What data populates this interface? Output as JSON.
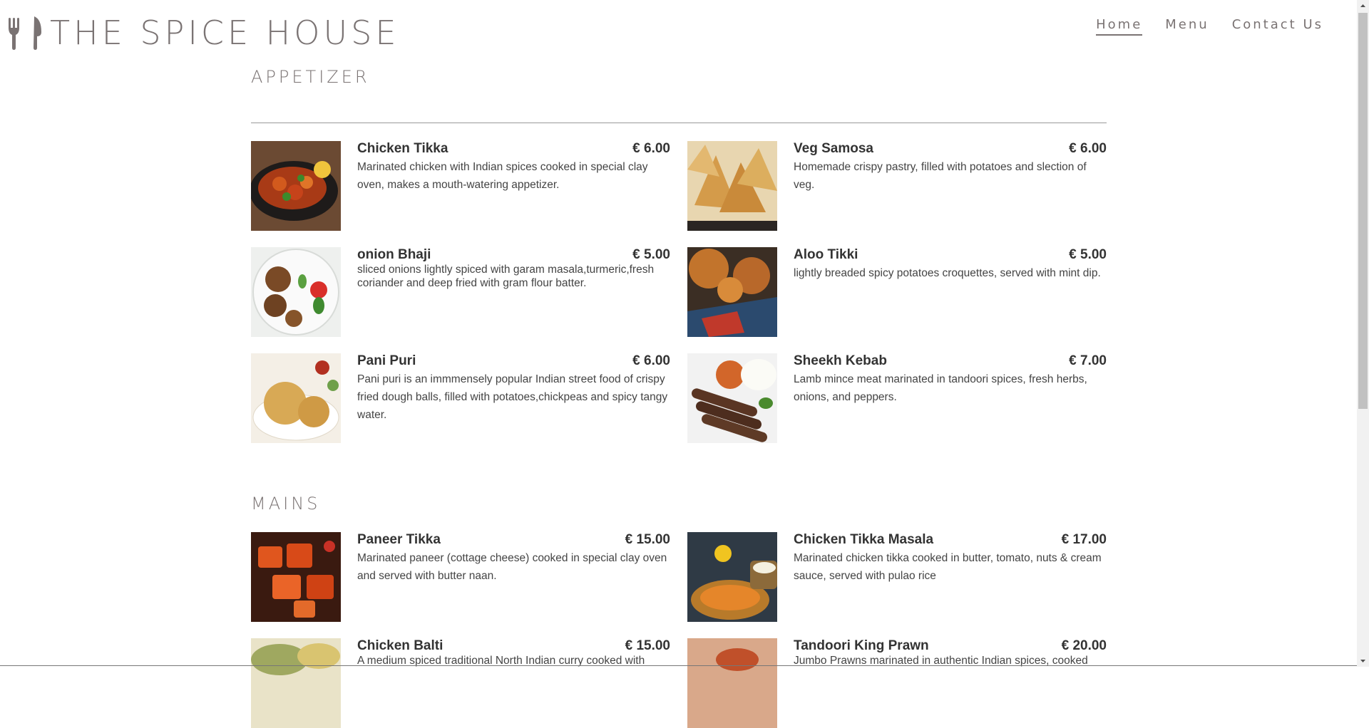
{
  "brand": {
    "title": "THE SPICE HOUSE",
    "icon": "fork-knife-icon"
  },
  "nav": [
    {
      "label": "Home",
      "active": true
    },
    {
      "label": "Menu",
      "active": false
    },
    {
      "label": "Contact Us",
      "active": false
    }
  ],
  "sections": [
    {
      "title": "APPETIZER",
      "items": [
        {
          "name": "Chicken Tikka",
          "price": "€ 6.00",
          "desc": "Marinated chicken with Indian spices cooked in special clay oven, makes a mouth-watering appetizer."
        },
        {
          "name": "Veg Samosa",
          "price": "€ 6.00",
          "desc": "Homemade crispy pastry, filled with potatoes and slection of veg."
        },
        {
          "name": "onion Bhaji",
          "price": "€ 5.00",
          "desc": "sliced onions lightly spiced with garam masala,turmeric,fresh coriander and deep fried with gram flour batter."
        },
        {
          "name": "Aloo Tikki",
          "price": "€ 5.00",
          "desc": "lightly breaded spicy potatoes croquettes, served with mint dip."
        },
        {
          "name": "Pani Puri",
          "price": "€ 6.00",
          "desc": "Pani puri is an immmensely popular Indian street food of crispy fried dough balls, filled with potatoes,chickpeas and spicy tangy water."
        },
        {
          "name": "Sheekh Kebab",
          "price": "€ 7.00",
          "desc": "Lamb mince meat marinated in tandoori spices, fresh herbs, onions, and peppers."
        }
      ]
    },
    {
      "title": "MAINS",
      "items": [
        {
          "name": "Paneer Tikka",
          "price": "€ 15.00",
          "desc": "Marinated paneer (cottage cheese) cooked in special clay oven and served with butter naan."
        },
        {
          "name": "Chicken Tikka Masala",
          "price": "€ 17.00",
          "desc": "Marinated chicken tikka cooked in butter, tomato, nuts & cream sauce, served with pulao rice"
        },
        {
          "name": "Chicken Balti",
          "price": "€ 15.00",
          "desc": "A medium spiced traditional North Indian curry cooked with"
        },
        {
          "name": "Tandoori King Prawn",
          "price": "€ 20.00",
          "desc": "Jumbo Prawns marinated in authentic Indian spices, cooked"
        }
      ]
    }
  ]
}
